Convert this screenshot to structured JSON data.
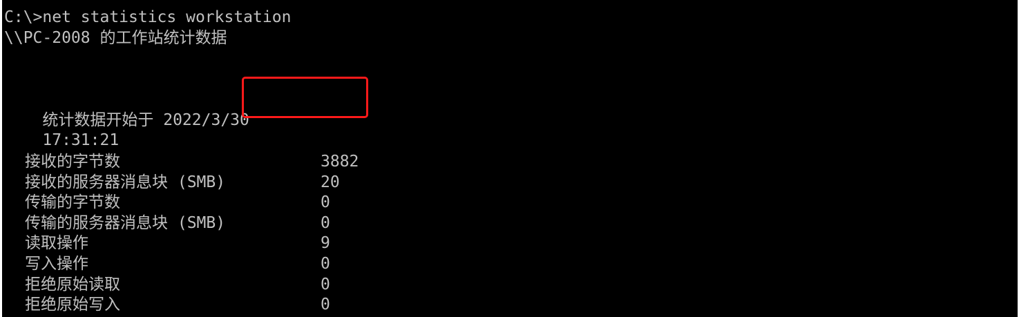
{
  "console": {
    "command_line": "C:\\>net statistics workstation",
    "header_line": "\\\\PC-2008 的工作站统计数据",
    "stats_start_label": "统计数据开始于 2022/3/30",
    "stats_start_time": "17:31:21",
    "stats": [
      {
        "label": "接收的字节数",
        "value": "3882"
      },
      {
        "label": "接收的服务器消息块 (SMB)",
        "value": "20"
      },
      {
        "label": "传输的字节数",
        "value": "0"
      },
      {
        "label": "传输的服务器消息块 (SMB)",
        "value": "0"
      },
      {
        "label": "读取操作",
        "value": "9"
      },
      {
        "label": "写入操作",
        "value": "0"
      },
      {
        "label": "拒绝原始读取",
        "value": "0"
      },
      {
        "label": "拒绝原始写入",
        "value": "0"
      }
    ]
  },
  "colors": {
    "background": "#000000",
    "text": "#c0c0c0",
    "highlight": "#ff1a1a"
  }
}
